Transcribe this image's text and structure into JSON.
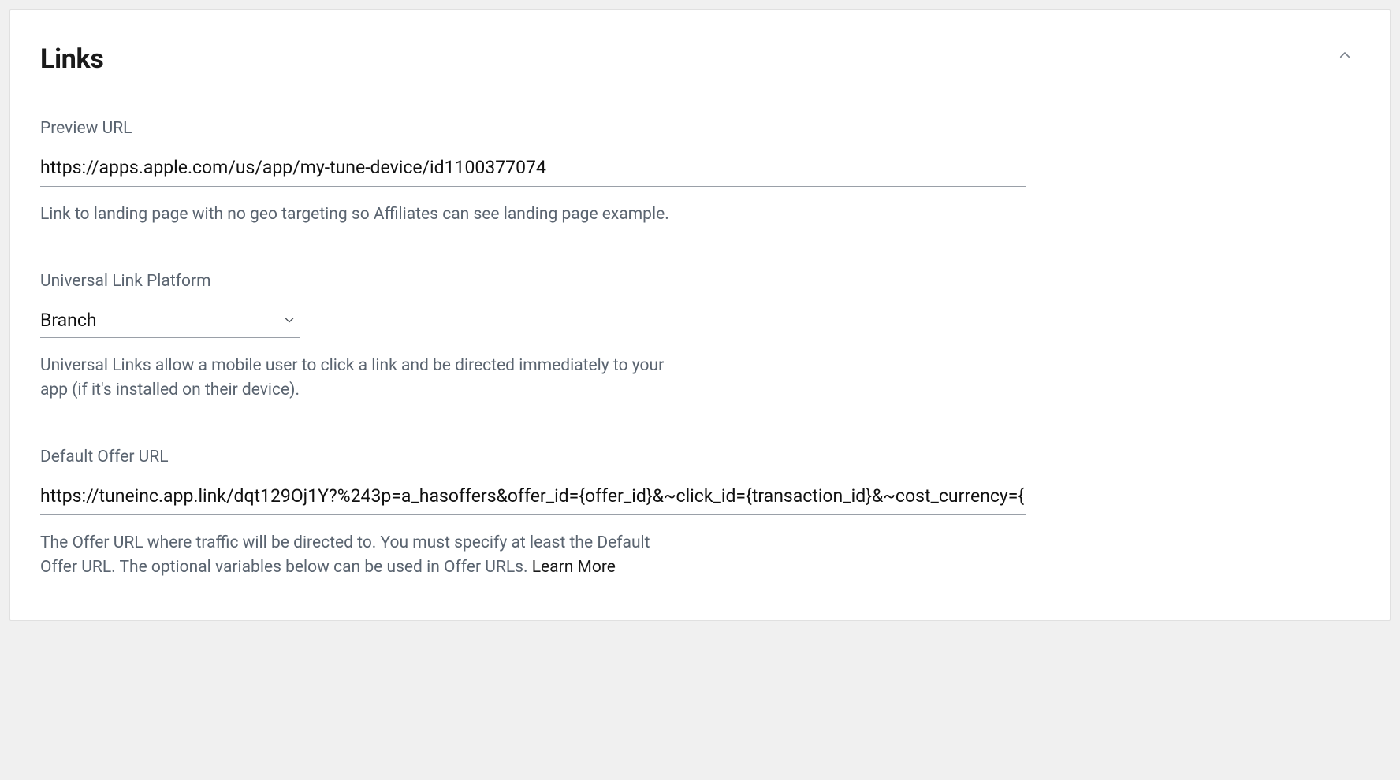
{
  "section": {
    "title": "Links"
  },
  "previewUrl": {
    "label": "Preview URL",
    "value": "https://apps.apple.com/us/app/my-tune-device/id1100377074",
    "help": "Link to landing page with no geo targeting so Affiliates can see landing page example."
  },
  "universalLink": {
    "label": "Universal Link Platform",
    "selected": "Branch",
    "help": "Universal Links allow a mobile user to click a link and be directed immediately to your app (if it's installed on their device)."
  },
  "defaultOfferUrl": {
    "label": "Default Offer URL",
    "value": "https://tuneinc.app.link/dqt129Oj1Y?%243p=a_hasoffers&offer_id={offer_id}&~click_id={transaction_id}&~cost_currency={",
    "helpPrefix": "The Offer URL where traffic will be directed to. You must specify at least the Default Offer URL. The optional variables below can be used in Offer URLs. ",
    "learnMore": "Learn More"
  }
}
